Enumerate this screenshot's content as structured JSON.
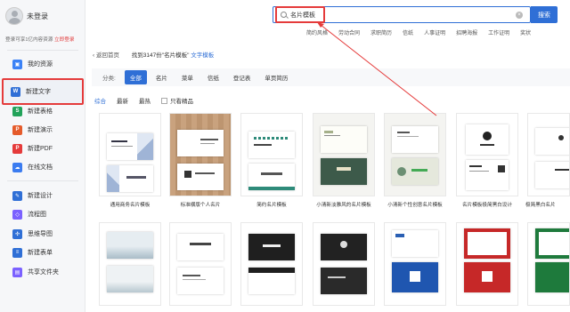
{
  "sidebar": {
    "login_name": "未登录",
    "login_tip": "登录可享1亿内容资源",
    "login_link": "立即登录",
    "items": [
      {
        "label": "我的资源",
        "icon": "folder-icon",
        "color": "#3b82f6"
      },
      {
        "label": "新建文字",
        "icon": "word-doc-icon",
        "color": "#2f6fd6"
      },
      {
        "label": "新建表格",
        "icon": "spreadsheet-icon",
        "color": "#22a35a"
      },
      {
        "label": "新建演示",
        "icon": "presentation-icon",
        "color": "#e55b2b"
      },
      {
        "label": "新建PDF",
        "icon": "pdf-icon",
        "color": "#e53b3b"
      },
      {
        "label": "在线文档",
        "icon": "cloud-doc-icon",
        "color": "#3b7cf0"
      },
      {
        "label": "新建设计",
        "icon": "design-icon",
        "color": "#2f6fd6"
      },
      {
        "label": "流程图",
        "icon": "flowchart-icon",
        "color": "#7b61ff"
      },
      {
        "label": "思维导图",
        "icon": "mindmap-icon",
        "color": "#2f6fd6"
      },
      {
        "label": "新建表单",
        "icon": "form-icon",
        "color": "#2f6fd6"
      },
      {
        "label": "共享文件夹",
        "icon": "shared-folder-icon",
        "color": "#7b61ff"
      }
    ]
  },
  "search": {
    "value": "名片模板",
    "button": "搜索",
    "hot_tags": [
      "简约风格",
      "劳动合同",
      "求职简历",
      "信纸",
      "人事证明",
      "招聘海报",
      "工作证明",
      "奖状"
    ]
  },
  "breadcrumb": {
    "back": "返回首页",
    "result_prefix": "找到3147份",
    "result_keyword": "\"名片模板\"",
    "result_suffix": "文字模板"
  },
  "filter": {
    "label": "分类:",
    "options": [
      "全部",
      "名片",
      "菜单",
      "信纸",
      "登记表",
      "单页简历"
    ]
  },
  "sort": {
    "options": [
      "综合",
      "最新",
      "最热"
    ],
    "checkbox_label": "只看精品"
  },
  "templates": [
    {
      "title": "通用商务名片模板"
    },
    {
      "title": "标准横版个人名片"
    },
    {
      "title": "简约名片模板"
    },
    {
      "title": "小清新淡雅风的名片模板"
    },
    {
      "title": "小清新个性创意名片模板"
    },
    {
      "title": "名片模板极简黑白设计"
    },
    {
      "title": "极简黑白名片"
    },
    {
      "title": ""
    },
    {
      "title": ""
    },
    {
      "title": ""
    },
    {
      "title": ""
    },
    {
      "title": ""
    },
    {
      "title": ""
    },
    {
      "title": ""
    }
  ],
  "colors": {
    "accent": "#2f6fd6",
    "highlight": "#e53b3b"
  }
}
